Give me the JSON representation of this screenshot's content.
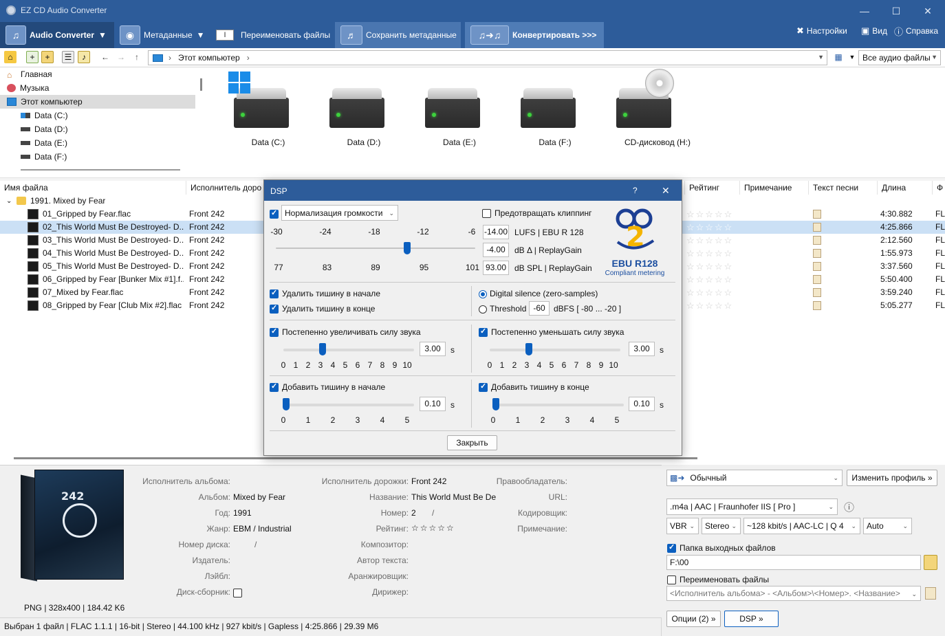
{
  "window": {
    "title": "EZ CD Audio Converter"
  },
  "ribbon": {
    "audio_converter": "Audio Converter",
    "metadata": "Метаданные",
    "rename": "Переименовать файлы",
    "save_meta": "Сохранить метаданные",
    "convert": "Конвертировать >>>",
    "settings": "Настройки",
    "view": "Вид",
    "help": "Справка"
  },
  "nav": {
    "address": "Этот компьютер",
    "filter": "Все аудио файлы"
  },
  "tree": [
    {
      "label": "Главная"
    },
    {
      "label": "Музыка"
    },
    {
      "label": "Этот компьютер"
    },
    {
      "label": "Data (C:)"
    },
    {
      "label": "Data (D:)"
    },
    {
      "label": "Data (E:)"
    },
    {
      "label": "Data (F:)"
    }
  ],
  "drives": [
    {
      "label": "Data (C:)"
    },
    {
      "label": "Data (D:)"
    },
    {
      "label": "Data (E:)"
    },
    {
      "label": "Data (F:)"
    },
    {
      "label": "CD-дисковод (H:)"
    }
  ],
  "filelist": {
    "columns": [
      "Имя файла",
      "Исполнитель доро",
      "Рейтинг",
      "Примечание",
      "Текст песни",
      "Длина",
      "Ф"
    ],
    "folder": "1991. Mixed by Fear",
    "rows": [
      {
        "name": "01_Gripped by Fear.flac",
        "artist": "Front 242",
        "length": "4:30.882",
        "fmt": "FL"
      },
      {
        "name": "02_This World Must Be Destroyed- D...",
        "artist": "Front 242",
        "length": "4:25.866",
        "fmt": "FL"
      },
      {
        "name": "03_This World Must Be Destroyed- D...",
        "artist": "Front 242",
        "length": "2:12.560",
        "fmt": "FL"
      },
      {
        "name": "04_This World Must Be Destroyed- D...",
        "artist": "Front 242",
        "length": "1:55.973",
        "fmt": "FL"
      },
      {
        "name": "05_This World Must Be Destroyed- D...",
        "artist": "Front 242",
        "length": "3:37.560",
        "fmt": "FL"
      },
      {
        "name": "06_Gripped by Fear [Bunker Mix #1].f...",
        "artist": "Front 242",
        "length": "5:50.400",
        "fmt": "FL"
      },
      {
        "name": "07_Mixed by Fear.flac",
        "artist": "Front 242",
        "length": "3:59.240",
        "fmt": "FL"
      },
      {
        "name": "08_Gripped by Fear [Club Mix #2].flac",
        "artist": "Front 242",
        "length": "5:05.277",
        "fmt": "FL"
      }
    ]
  },
  "dsp": {
    "title": "DSP",
    "help": "?",
    "close": "✕",
    "normalize_mode": "Нормализация громкости",
    "prevent_clip": "Предотвращать клиппинг",
    "top_ticks": [
      "-30",
      "-24",
      "-18",
      "-12",
      "-6"
    ],
    "bottom_ticks": [
      "77",
      "83",
      "89",
      "95",
      "101"
    ],
    "lufs_value": "-14.00",
    "lufs_label": "LUFS | EBU R 128",
    "db_value": "-4.00",
    "db_label": "dB Δ | ReplayGain",
    "spl_value": "93.00",
    "spl_label": "dB SPL | ReplayGain",
    "ebu_title": "EBU R128",
    "ebu_sub": "Compliant metering",
    "remove_start": "Удалить тишину в начале",
    "remove_end": "Удалить тишину в конце",
    "digital_silence": "Digital silence (zero-samples)",
    "threshold": "Threshold",
    "threshold_value": "-60",
    "threshold_range": "dBFS [ -80 ... -20 ]",
    "fade_in": "Постепенно увеличивать силу звука",
    "fade_out": "Постепенно уменьшать силу звука",
    "fade_ticks": [
      "0",
      "1",
      "2",
      "3",
      "4",
      "5",
      "6",
      "7",
      "8",
      "9",
      "10"
    ],
    "fade_in_value": "3.00",
    "fade_out_value": "3.00",
    "unit_s": "s",
    "add_start": "Добавить тишину в начале",
    "add_end": "Добавить тишину в конце",
    "add_ticks": [
      "0",
      "1",
      "2",
      "3",
      "4",
      "5"
    ],
    "add_start_value": "0.10",
    "add_end_value": "0.10",
    "close_btn": "Закрыть"
  },
  "details": {
    "cover_info": "PNG | 328x400 | 184.42 K6",
    "album_artist_l": "Исполнитель альбома:",
    "album_l": "Альбом:",
    "album": "Mixed by Fear",
    "year_l": "Год:",
    "year": "1991",
    "genre_l": "Жанр:",
    "genre": "EBM / Industrial",
    "disc_l": "Номер диска:",
    "disc": "/",
    "publisher_l": "Издатель:",
    "label_l": "Лэйбл:",
    "compilation_l": "Диск-сборник:",
    "track_artist_l": "Исполнитель дорожки:",
    "track_artist": "Front 242",
    "title_l": "Название:",
    "title": "This World Must Be De",
    "number_l": "Номер:",
    "number": "2",
    "number_sep": "/",
    "rating_l": "Рейтинг:",
    "composer_l": "Композитор:",
    "lyricist_l": "Автор текста:",
    "arranger_l": "Аранжировщик:",
    "conductor_l": "Дирижер:",
    "copyright_l": "Правообладатель:",
    "url_l": "URL:",
    "encoder_l": "Кодировщик:",
    "comment_l": "Примечание:"
  },
  "output": {
    "profile": "Обычный",
    "change_profile": "Изменить профиль »",
    "codec": ".m4a  |  AAC  |  Fraunhofer IIS [ Pro ]",
    "mode": "VBR",
    "channels": "Stereo",
    "bitrate": "~128 kbit/s | AAC-LC | Q 4",
    "rate": "Auto",
    "output_folder": "Папка выходных файлов",
    "folder_path": "F:\\00",
    "rename_files": "Переименовать файлы",
    "pattern": "<Исполнитель альбома> - <Альбом>\\<Номер>. <Название>",
    "options": "Опции (2) »",
    "dsp": "DSP »"
  },
  "status": {
    "text": "Выбран 1 файл  |  FLAC 1.1.1  |  16-bit  |  Stereo  |  44.100 kHz  |  927 kbit/s  |  Gapless  |  4:25.866  |  29.39 M6"
  },
  "colors": {
    "titlebar": "#2d5c9a",
    "accent": "#0b5fbf",
    "selection": "#cbe0f5"
  }
}
